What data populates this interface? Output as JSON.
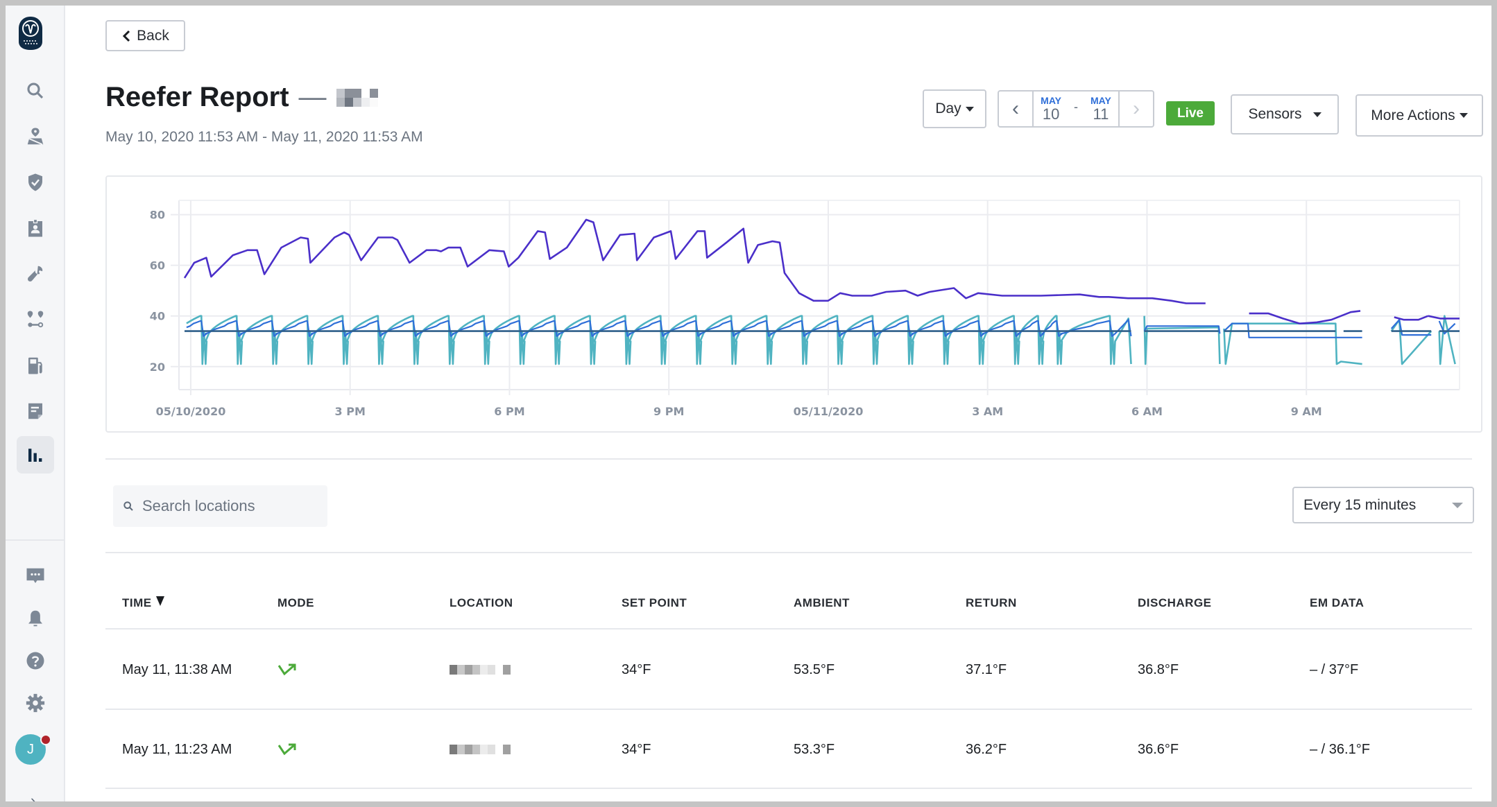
{
  "sidebar": {
    "logo": "owl-logo",
    "nav_items": [
      {
        "name": "search",
        "icon": "search-icon"
      },
      {
        "name": "map",
        "icon": "map-pin-icon"
      },
      {
        "name": "safety",
        "icon": "shield-check-icon"
      },
      {
        "name": "drivers",
        "icon": "badge-icon"
      },
      {
        "name": "maintenance",
        "icon": "wrench-icon"
      },
      {
        "name": "dispatch",
        "icon": "route-icon"
      },
      {
        "name": "fuel",
        "icon": "fuel-pump-icon"
      },
      {
        "name": "documents",
        "icon": "document-icon"
      },
      {
        "name": "reports",
        "icon": "bar-chart-icon",
        "active": true
      }
    ],
    "bottom_items": [
      {
        "name": "messages",
        "icon": "chat-icon"
      },
      {
        "name": "alerts",
        "icon": "bell-icon"
      },
      {
        "name": "help",
        "icon": "help-icon"
      },
      {
        "name": "settings",
        "icon": "gear-icon"
      }
    ],
    "avatar_initial": "J",
    "expand_glyph": "›"
  },
  "header": {
    "back_label": "Back",
    "title": "Reefer Report",
    "title_separator": "—",
    "date_range_text": "May 10, 2020 11:53 AM - May 11, 2020 11:53 AM"
  },
  "toolbar": {
    "period_label": "Day",
    "start_month": "MAY",
    "start_day": "10",
    "range_sep": "-",
    "end_month": "MAY",
    "end_day": "11",
    "live_label": "Live",
    "sensors_label": "Sensors",
    "more_actions_label": "More Actions"
  },
  "colors": {
    "live_green": "#4caa3a",
    "ambient": "#4a2fc9",
    "return": "#2f6fd8",
    "discharge": "#4fb3c1",
    "set_point": "#2e5f8a",
    "accent_blue": "#2f6fd8"
  },
  "chart_data": {
    "type": "line",
    "title": "",
    "xlabel": "",
    "ylabel": "",
    "x_unit": "hours since 05/10/2020 00:00",
    "xlim": [
      11.883,
      35.883
    ],
    "ylim": [
      12,
      84
    ],
    "y_ticks": [
      20,
      40,
      60,
      80
    ],
    "x_ticks": [
      {
        "value": 12,
        "label": "05/10/2020"
      },
      {
        "value": 15,
        "label": "3 PM"
      },
      {
        "value": 18,
        "label": "6 PM"
      },
      {
        "value": 21,
        "label": "9 PM"
      },
      {
        "value": 24,
        "label": "05/11/2020"
      },
      {
        "value": 27,
        "label": "3 AM"
      },
      {
        "value": 30,
        "label": "6 AM"
      },
      {
        "value": 33,
        "label": "9 AM"
      }
    ],
    "grid": true,
    "legend": "none",
    "series": [
      {
        "name": "Ambient",
        "color": "#4a2fc9",
        "segments": [
          [
            [
              11.9,
              55
            ],
            [
              12.1,
              61
            ],
            [
              12.35,
              63
            ],
            [
              12.45,
              55.5
            ],
            [
              12.9,
              64
            ],
            [
              13.2,
              66
            ],
            [
              13.4,
              66
            ],
            [
              13.55,
              56.5
            ],
            [
              13.9,
              67
            ],
            [
              14.3,
              71
            ],
            [
              14.45,
              70.5
            ],
            [
              14.5,
              61
            ],
            [
              15.0,
              71
            ],
            [
              15.2,
              73
            ],
            [
              15.3,
              72
            ],
            [
              15.55,
              62
            ],
            [
              15.9,
              71
            ],
            [
              16.2,
              71
            ],
            [
              16.3,
              70
            ],
            [
              16.55,
              61
            ],
            [
              16.9,
              66
            ],
            [
              17.1,
              66
            ],
            [
              17.2,
              65.5
            ],
            [
              17.35,
              67
            ],
            [
              17.6,
              67
            ],
            [
              17.75,
              59.5
            ],
            [
              18.2,
              66
            ],
            [
              18.5,
              65.5
            ],
            [
              18.6,
              59.5
            ],
            [
              18.8,
              63
            ],
            [
              19.2,
              73.5
            ],
            [
              19.35,
              73
            ],
            [
              19.45,
              62.5
            ],
            [
              19.8,
              67
            ],
            [
              20.2,
              78
            ],
            [
              20.35,
              77
            ],
            [
              20.55,
              62
            ],
            [
              20.9,
              72
            ],
            [
              21.2,
              72.5
            ],
            [
              21.25,
              62
            ],
            [
              21.6,
              71
            ],
            [
              21.95,
              73.5
            ],
            [
              22.05,
              62.5
            ],
            [
              22.5,
              73.5
            ],
            [
              22.65,
              73.5
            ],
            [
              22.7,
              63
            ],
            [
              23.1,
              69
            ],
            [
              23.45,
              74.5
            ],
            [
              23.55,
              61
            ],
            [
              23.75,
              68
            ],
            [
              24.05,
              69.5
            ],
            [
              24.2,
              69
            ],
            [
              24.3,
              57
            ],
            [
              24.6,
              49
            ],
            [
              24.9,
              46
            ],
            [
              25.2,
              46
            ],
            [
              25.45,
              49
            ],
            [
              25.7,
              48
            ],
            [
              26.1,
              48
            ],
            [
              26.4,
              49.5
            ],
            [
              26.8,
              50
            ],
            [
              27.05,
              48
            ],
            [
              27.3,
              49.5
            ],
            [
              27.8,
              51
            ],
            [
              28.05,
              47
            ],
            [
              28.3,
              49
            ],
            [
              28.8,
              48
            ],
            [
              29.6,
              48
            ],
            [
              30.4,
              48.5
            ],
            [
              30.8,
              47.5
            ],
            [
              31.0,
              47.5
            ],
            [
              31.4,
              47
            ],
            [
              31.9,
              47
            ],
            [
              32.3,
              46
            ],
            [
              32.6,
              45
            ],
            [
              33.0,
              45
            ],
            [
              33.3,
              41
            ],
            [
              33.9,
              41
            ],
            [
              34.3,
              41
            ],
            [
              34.6,
              39
            ],
            [
              34.95,
              37
            ],
            [
              35.3,
              37.5
            ],
            [
              35.6,
              38.5
            ],
            [
              36.0,
              41.5
            ],
            [
              36.2,
              42
            ],
            [
              36.45,
              41
            ],
            [
              36.6,
              39
            ],
            [
              36.9,
              39.5
            ],
            [
              37.1,
              38.5
            ],
            [
              37.4,
              38.5
            ],
            [
              37.6,
              40
            ]
          ],
          [
            [
              37.6,
              40
            ],
            [
              37.85,
              39
            ],
            [
              38.25,
              39
            ]
          ]
        ]
      },
      {
        "name": "Return",
        "color": "#2f6fd8",
        "values_note": "cycles between ~33 and ~38 °F in step pattern"
      },
      {
        "name": "Discharge",
        "color": "#4fb3c1",
        "values_note": "defrost spikes down to ~21 °F, recovers to ~40 °F each ~40 min cycle"
      },
      {
        "name": "Set Point",
        "color": "#2e5f8a",
        "value": 34
      }
    ]
  },
  "filters": {
    "search_placeholder": "Search locations",
    "interval_selected": "Every 15 minutes"
  },
  "table": {
    "columns": [
      "TIME",
      "MODE",
      "LOCATION",
      "SET POINT",
      "AMBIENT",
      "RETURN",
      "DISCHARGE",
      "EM DATA"
    ],
    "sort_column": "TIME",
    "sort_direction": "desc",
    "rows": [
      {
        "time": "May 11, 11:38 AM",
        "mode": "cooling-icon",
        "location": "[redacted]",
        "set_point": "34°F",
        "ambient": "53.5°F",
        "return": "37.1°F",
        "discharge": "36.8°F",
        "em_data": "– / 37°F"
      },
      {
        "time": "May 11, 11:23 AM",
        "mode": "cooling-icon",
        "location": "[redacted]",
        "set_point": "34°F",
        "ambient": "53.3°F",
        "return": "36.2°F",
        "discharge": "36.6°F",
        "em_data": "– / 36.1°F"
      }
    ]
  }
}
